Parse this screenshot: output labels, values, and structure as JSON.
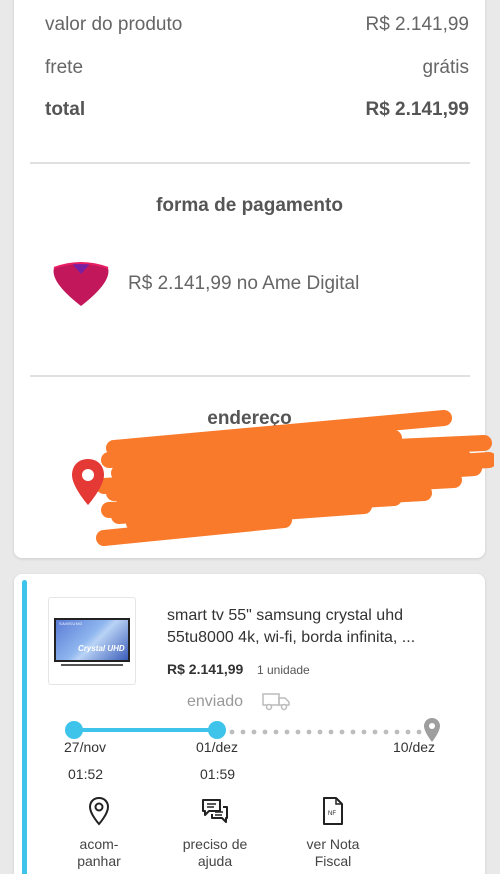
{
  "summary": {
    "product_value_label": "valor do produto",
    "product_value": "R$ 2.141,99",
    "shipping_label": "frete",
    "shipping_value": "grátis",
    "total_label": "total",
    "total_value": "R$ 2.141,99"
  },
  "payment": {
    "title": "forma de pagamento",
    "description": "R$ 2.141,99 no Ame Digital",
    "icon": "ame-digital-logo-icon",
    "brand_color": "#c2185b"
  },
  "address": {
    "title": "endereço",
    "icon": "location-pin-icon",
    "redaction_color": "#f97a2b"
  },
  "order": {
    "accent_color": "#3ec3ea",
    "product": {
      "name": "smart tv 55\" samsung crystal uhd 55tu8000 4k, wi-fi, borda infinita, ...",
      "price": "R$ 2.141,99",
      "quantity": "1 unidade",
      "thumb_brand": "SAMSUNG",
      "thumb_label": "Crystal UHD"
    },
    "status": "enviado",
    "status_icon": "truck-icon",
    "timeline": [
      {
        "date": "27/nov",
        "time": "01:52"
      },
      {
        "date": "01/dez",
        "time": "01:59"
      },
      {
        "date": "10/dez",
        "time": ""
      }
    ],
    "actions": [
      {
        "label": "acom-panhar",
        "icon": "location-pin-icon"
      },
      {
        "label": "preciso de ajuda",
        "icon": "chat-icon"
      },
      {
        "label": "ver Nota Fiscal",
        "icon": "invoice-icon"
      }
    ]
  }
}
